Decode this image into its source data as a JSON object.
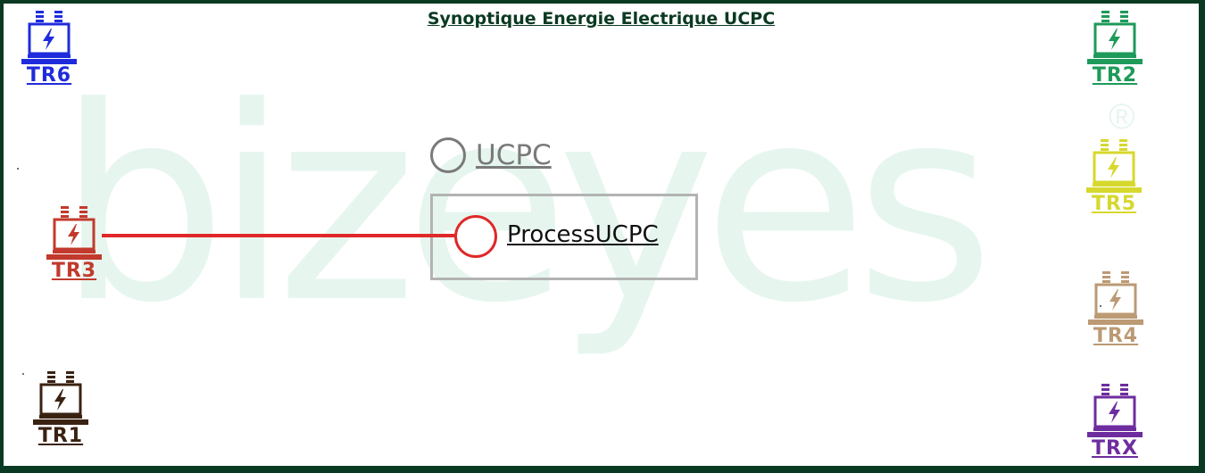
{
  "title": "Synoptique Energie Electrique UCPC",
  "watermark": {
    "text": "bizeyes",
    "mark": "®"
  },
  "transformers": [
    {
      "id": "tr6",
      "label": "TR6",
      "color": "#1f2bdc",
      "icon": "transformer-icon"
    },
    {
      "id": "tr2",
      "label": "TR2",
      "color": "#1e9a5a",
      "icon": "transformer-icon"
    },
    {
      "id": "tr5",
      "label": "TR5",
      "color": "#d6d82e",
      "icon": "transformer-icon"
    },
    {
      "id": "tr3",
      "label": "TR3",
      "color": "#c23a2c",
      "icon": "transformer-icon"
    },
    {
      "id": "tr4",
      "label": "TR4",
      "color": "#bb9a74",
      "icon": "transformer-icon"
    },
    {
      "id": "tr1",
      "label": "TR1",
      "color": "#3a2212",
      "icon": "transformer-icon"
    },
    {
      "id": "trx",
      "label": "TRX",
      "color": "#6e2d9e",
      "icon": "transformer-icon"
    }
  ],
  "ucpc": {
    "label": "UCPC",
    "color": "#7a7a7a"
  },
  "process": {
    "label": "ProcessUCPC",
    "color": "#e02828"
  }
}
